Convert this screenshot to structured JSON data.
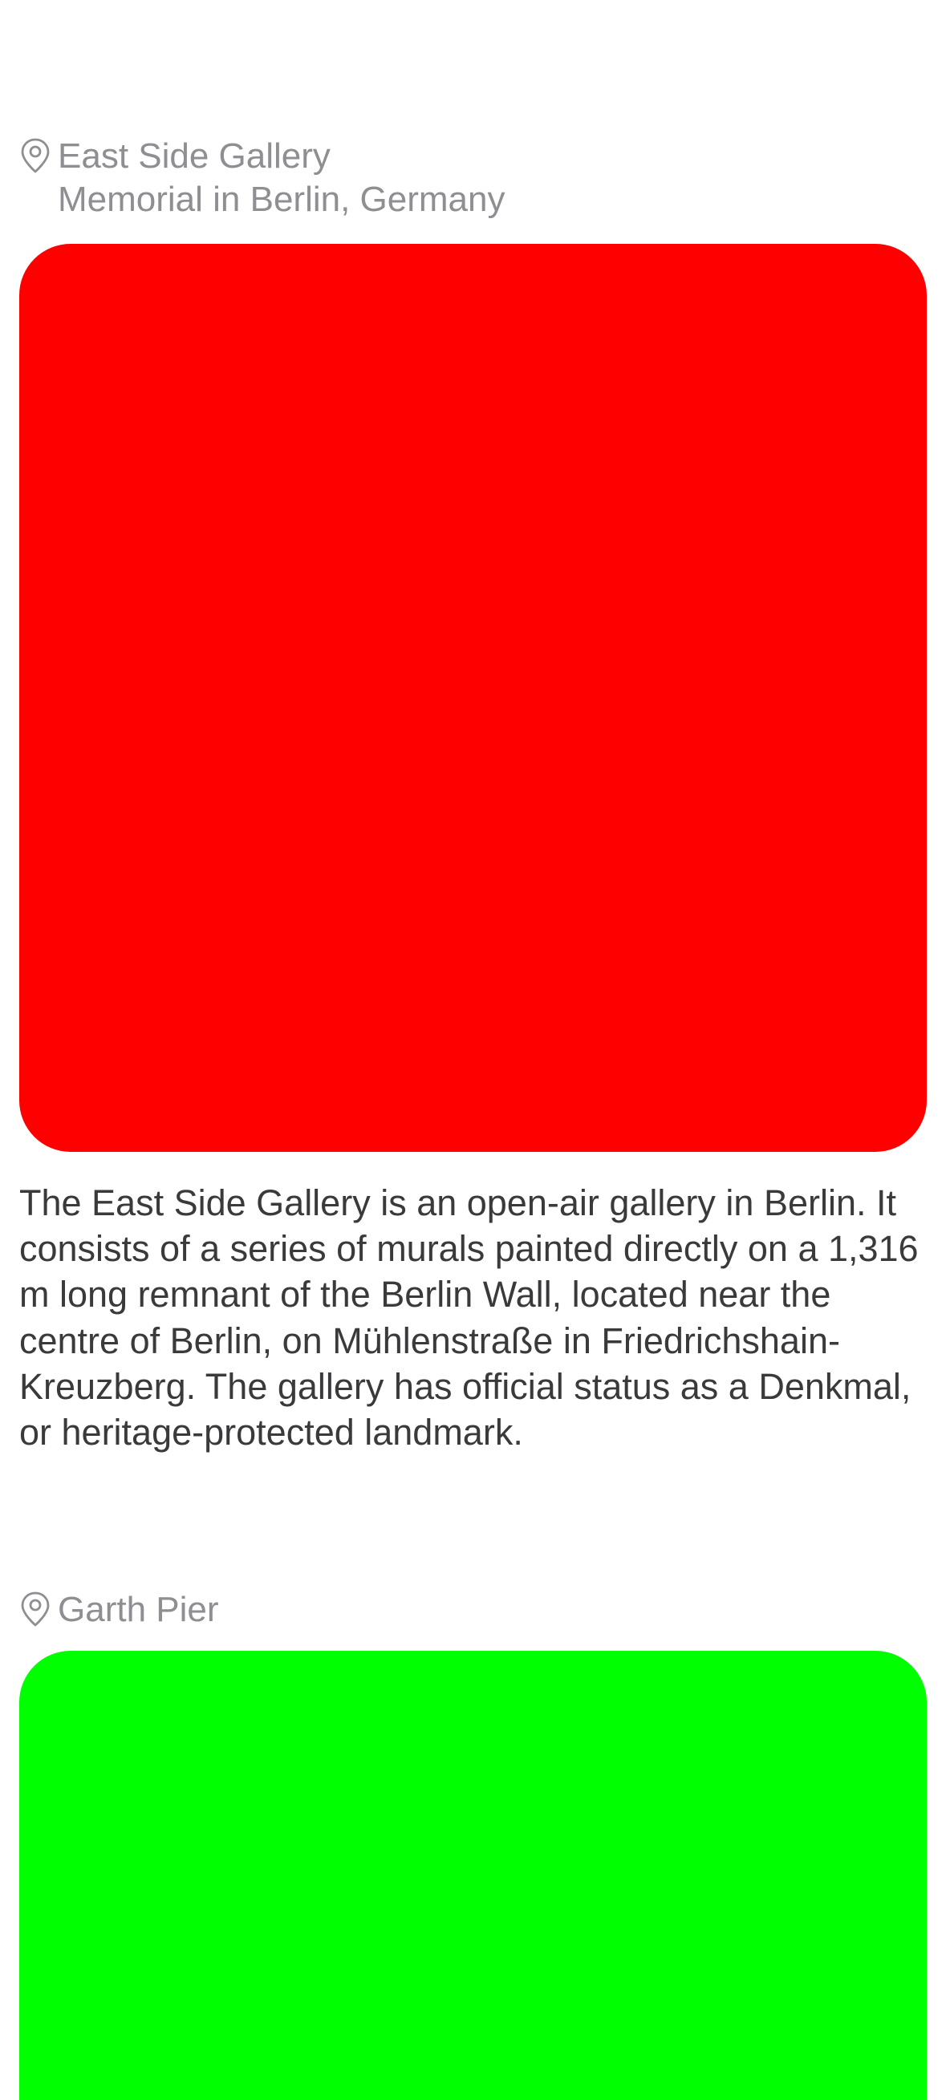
{
  "places": [
    {
      "name": "East Side Gallery",
      "subtitle": "Memorial in Berlin, Germany",
      "image_color": "#ff0000",
      "description": "The East Side Gallery is an open-air gallery in Berlin. It consists of a series of murals painted directly on a 1,316 m long remnant of the Berlin Wall, located near the centre of Berlin, on Mühlenstraße in Friedrichshain-Kreuzberg. The gallery has official status as a Denkmal, or heritage-protected landmark.",
      "icon": "location-pin-icon"
    },
    {
      "name": "Garth Pier",
      "image_color": "#00ff00",
      "icon": "location-pin-icon"
    }
  ]
}
